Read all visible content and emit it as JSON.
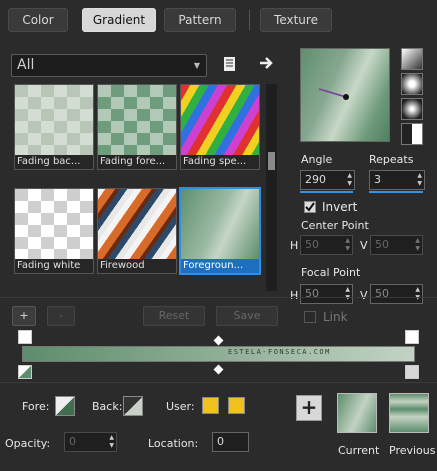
{
  "tabs": [
    {
      "label": "Color",
      "active": false
    },
    {
      "label": "Gradient",
      "active": true
    },
    {
      "label": "Pattern",
      "active": false
    },
    {
      "label": "Texture",
      "active": false
    }
  ],
  "category": {
    "selected": "All"
  },
  "gradients": [
    {
      "name": "Fading bac...",
      "selected": false
    },
    {
      "name": "Fading fore...",
      "selected": false
    },
    {
      "name": "Fading spe...",
      "selected": false
    },
    {
      "name": "Fading white",
      "selected": false
    },
    {
      "name": "Firewood",
      "selected": false
    },
    {
      "name": "Foregroun...",
      "selected": true
    }
  ],
  "buttons": {
    "add": "+",
    "remove": "-",
    "reset": "Reset",
    "save": "Save"
  },
  "angle": {
    "label": "Angle",
    "value": "290"
  },
  "repeats": {
    "label": "Repeats",
    "value": "3"
  },
  "invert": {
    "label": "Invert",
    "checked": true
  },
  "center_point": {
    "label": "Center Point",
    "h_label": "H",
    "h_value": "50",
    "v_label": "V",
    "v_value": "50"
  },
  "focal_point": {
    "label": "Focal Point",
    "h_label": "H",
    "h_value": "50",
    "v_label": "V",
    "v_value": "50"
  },
  "link": {
    "label": "Link",
    "checked": false
  },
  "watermark": "ESTELA-FONSECA.COM",
  "bottom": {
    "fore_label": "Fore:",
    "back_label": "Back:",
    "user_label": "User:",
    "opacity_label": "Opacity:",
    "opacity_value": "0",
    "location_label": "Location:",
    "location_value": "0",
    "add_symbol": "+",
    "current_label": "Current",
    "previous_label": "Previous"
  },
  "colors": {
    "accent": "#2e8ee6",
    "user_swatch": "#f0c020",
    "gradient_start": "#5d8d6c",
    "gradient_end": "#c3d3c3"
  }
}
